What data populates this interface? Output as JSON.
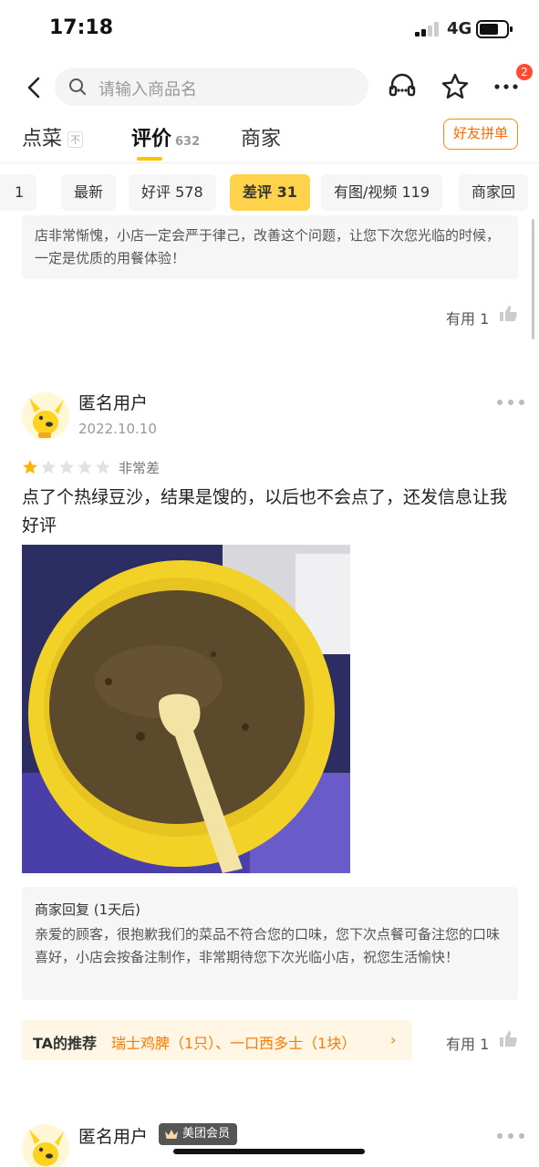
{
  "status_bar": {
    "time": "17:18",
    "network": "4G"
  },
  "header": {
    "search_placeholder": "请输入商品名",
    "cart_badge": "2"
  },
  "tabs": [
    {
      "label": "点菜",
      "tag": "不"
    },
    {
      "label": "评价",
      "count": "632"
    },
    {
      "label": "商家"
    }
  ],
  "group_order_label": "好友拼单",
  "filters": [
    {
      "label": "1"
    },
    {
      "label": "最新"
    },
    {
      "label": "好评 578"
    },
    {
      "label": "差评 31"
    },
    {
      "label": "有图/视频 119"
    },
    {
      "label": "商家回"
    }
  ],
  "previous_review": {
    "reply_text": "店非常惭愧，小店一定会严于律己，改善这个问题，让您下次您光临的时候，一定是优质的用餐体验！",
    "useful_label": "有用 1"
  },
  "review": {
    "user": "匿名用户",
    "date": "2022.10.10",
    "rating_text": "非常差",
    "text": "点了个热绿豆沙，结果是馊的，以后也不会点了，还发信息让我好评",
    "merchant_reply_title": "商家回复 (1天后)",
    "merchant_reply": "亲爱的顾客，很抱歉我们的菜品不符合您的口味，您下次点餐可备注您的口味喜好，小店会按备注制作，非常期待您下次光临小店，祝您生活愉快！",
    "recommend_label": "TA的推荐",
    "recommend_items": "瑞士鸡脾（1只）、一口西多士（1块）",
    "useful_label": "有用 1"
  },
  "next_review": {
    "user": "匿名用户",
    "member_badge": "美团会员"
  },
  "colors": {
    "accent": "#ffc300",
    "accent_orange": "#ff7a00",
    "chip_active": "#ffd24c"
  }
}
